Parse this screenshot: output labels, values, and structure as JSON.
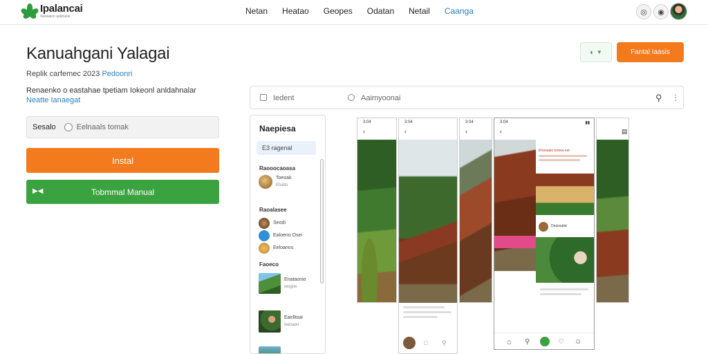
{
  "brand": {
    "name": "Ipalancai",
    "tagline": "Sewaiacn aulenaoe"
  },
  "nav": {
    "links": [
      "Netan",
      "Heatao",
      "Geopes",
      "Odatan",
      "Netail",
      "Caanga"
    ],
    "active_index": 5
  },
  "app": {
    "title": "Kanuahgani Yalagai",
    "meta": "Replik carfemec 2023",
    "meta_link": "Pedoonri",
    "desc": "Renaenko o eastahae tpetiam Iokeonl anldahnalar",
    "desc_link": "Neatte Ianaegat",
    "select_label": "Sesalo",
    "select_value": "Eelnaals tomak",
    "install_label": "Instal",
    "manual_label": "Tobmmal Manual",
    "orange_label": "Fantal Iaasis"
  },
  "search": {
    "field1": "Iedent",
    "field2": "Aaimyoonai"
  },
  "sidebar": {
    "title": "Naepiesa",
    "pill": "E3 ragenal",
    "sections": [
      {
        "title": "Raooocaoasa",
        "items": [
          {
            "label": "Toeoak",
            "sub": "Ehatto"
          }
        ]
      },
      {
        "title": "Raoalasee",
        "items": [
          {
            "label": "Seodi"
          },
          {
            "label": "Ealoeno Osei"
          },
          {
            "label": "Eeloanos"
          }
        ]
      },
      {
        "title": "Faoeco",
        "items": [
          {
            "label": "Enataonio",
            "sub": "Ieogne"
          },
          {
            "label": "Eaelltoai",
            "sub": "Ieesaon"
          }
        ]
      }
    ]
  },
  "screens": {
    "badge_label": "Ehanaalo tontoa eal",
    "caption": "Deaosatat"
  },
  "colors": {
    "accent": "#2a7fc1",
    "install": "#f47a1e",
    "manual": "#3aa23f",
    "brand": "#2e9b3d"
  },
  "icons": [
    "logo-leaf-icon",
    "bell-icon",
    "help-icon",
    "document-icon",
    "circle-icon",
    "search-icon",
    "more-icon",
    "share-icon",
    "chevron-down-icon",
    "back-arrow-icon",
    "home-icon",
    "heart-icon",
    "profile-icon"
  ]
}
